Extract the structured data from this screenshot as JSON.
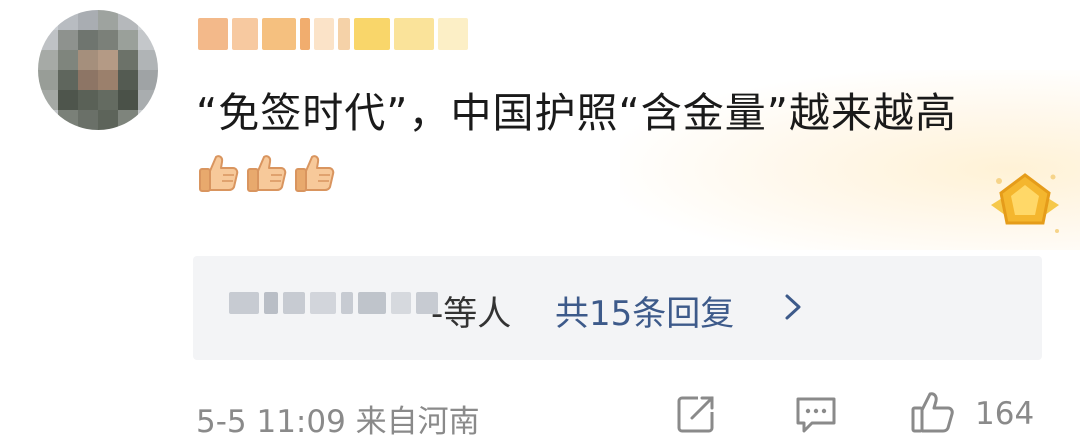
{
  "user": {
    "avatar_icon": "pixelated-avatar",
    "username_censored": true
  },
  "comment": {
    "text": "“免签时代”，中国护照“含金量”越来越高",
    "emoji_icon": "thumbs-up-icon",
    "emoji_count": 3
  },
  "badge_icon": "gold-medal-icon",
  "reply": {
    "suffix": "-等人",
    "count_label": "共15条回复",
    "chevron_icon": "chevron-right-icon"
  },
  "footer": {
    "meta": "5-5 11:09 来自河南",
    "like_count": "164"
  },
  "colors": {
    "link": "#3d5a8a",
    "muted": "#8a8a8a",
    "reply_bg": "#f3f4f6"
  }
}
